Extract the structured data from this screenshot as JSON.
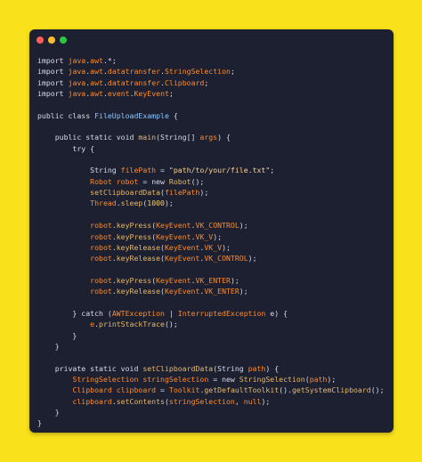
{
  "window": {
    "window_controls": [
      "close",
      "minimize",
      "maximize"
    ]
  },
  "code": {
    "lines": [
      [
        {
          "text": "import ",
          "type": "plain"
        },
        {
          "text": "java",
          "type": "ident"
        },
        {
          "text": ".",
          "type": "plain"
        },
        {
          "text": "awt",
          "type": "ident"
        },
        {
          "text": ".*;",
          "type": "plain"
        }
      ],
      [
        {
          "text": "import ",
          "type": "plain"
        },
        {
          "text": "java",
          "type": "ident"
        },
        {
          "text": ".",
          "type": "plain"
        },
        {
          "text": "awt",
          "type": "ident"
        },
        {
          "text": ".",
          "type": "plain"
        },
        {
          "text": "datatransfer",
          "type": "ident"
        },
        {
          "text": ".",
          "type": "plain"
        },
        {
          "text": "StringSelection",
          "type": "ident"
        },
        {
          "text": ";",
          "type": "plain"
        }
      ],
      [
        {
          "text": "import ",
          "type": "plain"
        },
        {
          "text": "java",
          "type": "ident"
        },
        {
          "text": ".",
          "type": "plain"
        },
        {
          "text": "awt",
          "type": "ident"
        },
        {
          "text": ".",
          "type": "plain"
        },
        {
          "text": "datatransfer",
          "type": "ident"
        },
        {
          "text": ".",
          "type": "plain"
        },
        {
          "text": "Clipboard",
          "type": "ident"
        },
        {
          "text": ";",
          "type": "plain"
        }
      ],
      [
        {
          "text": "import ",
          "type": "plain"
        },
        {
          "text": "java",
          "type": "ident"
        },
        {
          "text": ".",
          "type": "plain"
        },
        {
          "text": "awt",
          "type": "ident"
        },
        {
          "text": ".",
          "type": "plain"
        },
        {
          "text": "event",
          "type": "ident"
        },
        {
          "text": ".",
          "type": "plain"
        },
        {
          "text": "KeyEvent",
          "type": "ident"
        },
        {
          "text": ";",
          "type": "plain"
        }
      ],
      [],
      [
        {
          "text": "public class ",
          "type": "plain"
        },
        {
          "text": "FileUploadExample",
          "type": "type"
        },
        {
          "text": " {",
          "type": "plain"
        }
      ],
      [],
      [
        {
          "text": "    public static void ",
          "type": "plain"
        },
        {
          "text": "main",
          "type": "call"
        },
        {
          "text": "(String[] ",
          "type": "plain"
        },
        {
          "text": "args",
          "type": "ident"
        },
        {
          "text": ") {",
          "type": "plain"
        }
      ],
      [
        {
          "text": "        try {",
          "type": "plain"
        }
      ],
      [],
      [
        {
          "text": "            String ",
          "type": "plain"
        },
        {
          "text": "filePath",
          "type": "ident"
        },
        {
          "text": " = ",
          "type": "plain"
        },
        {
          "text": "\"path/to/your/file.txt\"",
          "type": "string"
        },
        {
          "text": ";",
          "type": "plain"
        }
      ],
      [
        {
          "text": "            ",
          "type": "plain"
        },
        {
          "text": "Robot",
          "type": "ident"
        },
        {
          "text": " ",
          "type": "plain"
        },
        {
          "text": "robot",
          "type": "ident"
        },
        {
          "text": " = new ",
          "type": "plain"
        },
        {
          "text": "Robot",
          "type": "call"
        },
        {
          "text": "();",
          "type": "plain"
        }
      ],
      [
        {
          "text": "            ",
          "type": "plain"
        },
        {
          "text": "setClipboardData",
          "type": "call"
        },
        {
          "text": "(",
          "type": "plain"
        },
        {
          "text": "filePath",
          "type": "ident"
        },
        {
          "text": ");",
          "type": "plain"
        }
      ],
      [
        {
          "text": "            ",
          "type": "plain"
        },
        {
          "text": "Thread",
          "type": "ident"
        },
        {
          "text": ".",
          "type": "plain"
        },
        {
          "text": "sleep",
          "type": "call"
        },
        {
          "text": "(",
          "type": "plain"
        },
        {
          "text": "1000",
          "type": "number"
        },
        {
          "text": ");",
          "type": "plain"
        }
      ],
      [],
      [
        {
          "text": "            ",
          "type": "plain"
        },
        {
          "text": "robot",
          "type": "ident"
        },
        {
          "text": ".",
          "type": "plain"
        },
        {
          "text": "keyPress",
          "type": "call"
        },
        {
          "text": "(",
          "type": "plain"
        },
        {
          "text": "KeyEvent",
          "type": "ident"
        },
        {
          "text": ".",
          "type": "plain"
        },
        {
          "text": "VK_CONTROL",
          "type": "ident"
        },
        {
          "text": ");",
          "type": "plain"
        }
      ],
      [
        {
          "text": "            ",
          "type": "plain"
        },
        {
          "text": "robot",
          "type": "ident"
        },
        {
          "text": ".",
          "type": "plain"
        },
        {
          "text": "keyPress",
          "type": "call"
        },
        {
          "text": "(",
          "type": "plain"
        },
        {
          "text": "KeyEvent",
          "type": "ident"
        },
        {
          "text": ".",
          "type": "plain"
        },
        {
          "text": "VK_V",
          "type": "ident"
        },
        {
          "text": ");",
          "type": "plain"
        }
      ],
      [
        {
          "text": "            ",
          "type": "plain"
        },
        {
          "text": "robot",
          "type": "ident"
        },
        {
          "text": ".",
          "type": "plain"
        },
        {
          "text": "keyRelease",
          "type": "call"
        },
        {
          "text": "(",
          "type": "plain"
        },
        {
          "text": "KeyEvent",
          "type": "ident"
        },
        {
          "text": ".",
          "type": "plain"
        },
        {
          "text": "VK_V",
          "type": "ident"
        },
        {
          "text": ");",
          "type": "plain"
        }
      ],
      [
        {
          "text": "            ",
          "type": "plain"
        },
        {
          "text": "robot",
          "type": "ident"
        },
        {
          "text": ".",
          "type": "plain"
        },
        {
          "text": "keyRelease",
          "type": "call"
        },
        {
          "text": "(",
          "type": "plain"
        },
        {
          "text": "KeyEvent",
          "type": "ident"
        },
        {
          "text": ".",
          "type": "plain"
        },
        {
          "text": "VK_CONTROL",
          "type": "ident"
        },
        {
          "text": ");",
          "type": "plain"
        }
      ],
      [],
      [
        {
          "text": "            ",
          "type": "plain"
        },
        {
          "text": "robot",
          "type": "ident"
        },
        {
          "text": ".",
          "type": "plain"
        },
        {
          "text": "keyPress",
          "type": "call"
        },
        {
          "text": "(",
          "type": "plain"
        },
        {
          "text": "KeyEvent",
          "type": "ident"
        },
        {
          "text": ".",
          "type": "plain"
        },
        {
          "text": "VK_ENTER",
          "type": "ident"
        },
        {
          "text": ");",
          "type": "plain"
        }
      ],
      [
        {
          "text": "            ",
          "type": "plain"
        },
        {
          "text": "robot",
          "type": "ident"
        },
        {
          "text": ".",
          "type": "plain"
        },
        {
          "text": "keyRelease",
          "type": "call"
        },
        {
          "text": "(",
          "type": "plain"
        },
        {
          "text": "KeyEvent",
          "type": "ident"
        },
        {
          "text": ".",
          "type": "plain"
        },
        {
          "text": "VK_ENTER",
          "type": "ident"
        },
        {
          "text": ");",
          "type": "plain"
        }
      ],
      [],
      [
        {
          "text": "        } catch (",
          "type": "plain"
        },
        {
          "text": "AWTException",
          "type": "ident"
        },
        {
          "text": " | ",
          "type": "plain"
        },
        {
          "text": "InterruptedException",
          "type": "ident"
        },
        {
          "text": " e) {",
          "type": "plain"
        }
      ],
      [
        {
          "text": "            ",
          "type": "plain"
        },
        {
          "text": "e",
          "type": "ident"
        },
        {
          "text": ".",
          "type": "plain"
        },
        {
          "text": "printStackTrace",
          "type": "call"
        },
        {
          "text": "();",
          "type": "plain"
        }
      ],
      [
        {
          "text": "        }",
          "type": "plain"
        }
      ],
      [
        {
          "text": "    }",
          "type": "plain"
        }
      ],
      [],
      [
        {
          "text": "    private static void ",
          "type": "plain"
        },
        {
          "text": "setClipboardData",
          "type": "call"
        },
        {
          "text": "(String ",
          "type": "plain"
        },
        {
          "text": "path",
          "type": "ident"
        },
        {
          "text": ") {",
          "type": "plain"
        }
      ],
      [
        {
          "text": "        ",
          "type": "plain"
        },
        {
          "text": "StringSelection",
          "type": "ident"
        },
        {
          "text": " ",
          "type": "plain"
        },
        {
          "text": "stringSelection",
          "type": "ident"
        },
        {
          "text": " = new ",
          "type": "plain"
        },
        {
          "text": "StringSelection",
          "type": "call"
        },
        {
          "text": "(",
          "type": "plain"
        },
        {
          "text": "path",
          "type": "ident"
        },
        {
          "text": ");",
          "type": "plain"
        }
      ],
      [
        {
          "text": "        ",
          "type": "plain"
        },
        {
          "text": "Clipboard",
          "type": "ident"
        },
        {
          "text": " ",
          "type": "plain"
        },
        {
          "text": "clipboard",
          "type": "ident"
        },
        {
          "text": " = ",
          "type": "plain"
        },
        {
          "text": "Toolkit",
          "type": "ident"
        },
        {
          "text": ".",
          "type": "plain"
        },
        {
          "text": "getDefaultToolkit",
          "type": "call"
        },
        {
          "text": "().",
          "type": "plain"
        },
        {
          "text": "getSystemClipboard",
          "type": "call"
        },
        {
          "text": "();",
          "type": "plain"
        }
      ],
      [
        {
          "text": "        ",
          "type": "plain"
        },
        {
          "text": "clipboard",
          "type": "ident"
        },
        {
          "text": ".",
          "type": "plain"
        },
        {
          "text": "setContents",
          "type": "call"
        },
        {
          "text": "(",
          "type": "plain"
        },
        {
          "text": "stringSelection",
          "type": "ident"
        },
        {
          "text": ", ",
          "type": "plain"
        },
        {
          "text": "null",
          "type": "ident"
        },
        {
          "text": ");",
          "type": "plain"
        }
      ],
      [
        {
          "text": "    }",
          "type": "plain"
        }
      ],
      [
        {
          "text": "}",
          "type": "plain"
        }
      ]
    ]
  },
  "theme": {
    "background": "#f9e21b",
    "window_bg": "#1d2030",
    "dot_red": "#ff5f56",
    "dot_yellow": "#ffbd2e",
    "dot_green": "#27c93f",
    "plain": "#d7dbe8",
    "ident": "#ff8a2a",
    "call": "#e6b86a",
    "type": "#8dc6ff",
    "string": "#ffd08a",
    "number": "#ffcc66"
  }
}
